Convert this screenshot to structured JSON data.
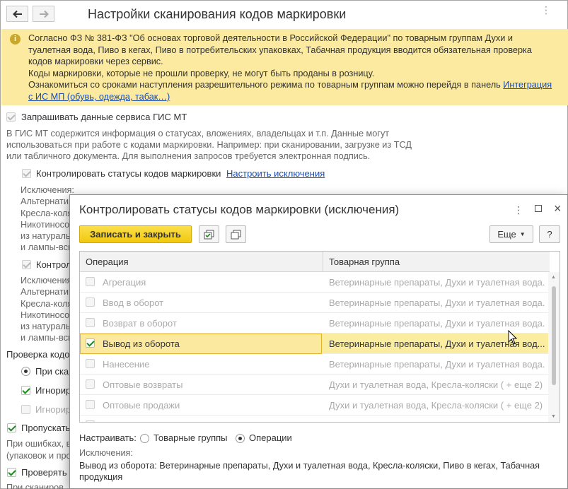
{
  "main": {
    "title": "Настройки сканирования кодов маркировки",
    "warning_lines": [
      "Согласно ФЗ № 381-ФЗ \"Об основах торговой деятельности в Российской Федерации\" по товарным группам Духи и",
      "туалетная вода, Пиво в кегах, Пиво в потребительских упаковках, Табачная продукция вводится обязательная проверка",
      "кодов маркировки через сервис.",
      "Коды маркировки, которые не прошли проверку, не могут быть проданы в розницу.",
      "Ознакомиться со сроками наступления разрешительного режима по товарным группам можно перейдя в панель "
    ],
    "warning_link_a": "Интеграция",
    "warning_link_b": "с ИС МП (обувь, одежда, табак…)",
    "gis_checkbox_label": "Запрашивать данные сервиса ГИС МТ",
    "gis_description": [
      "В ГИС МТ содержится информация о статусах, вложениях, владельцах и т.п. Данные могут",
      "использоваться при работе с кодами маркировки. Например: при сканировании, загрузке из ТСД",
      "или табличного документа. Для выполнения запросов требуется электронная подпись."
    ],
    "control_status_label": "Контролировать статусы кодов маркировки",
    "configure_exceptions_link": "Настроить исключения",
    "exceptions_block1": [
      "Исключения:",
      "Альтернатив",
      "Кресла-коляс",
      "Никотиносо",
      "из натураль",
      "и лампы-всп"
    ],
    "control_label_2": "Контрол",
    "exceptions_block2": [
      "Исключения",
      "Альтернатив",
      "Кресла-коляс",
      "Никотиносо",
      "из натураль",
      "и лампы-всп"
    ],
    "verify_codes_label": "Проверка кодо",
    "radio_scan_label": "При скан",
    "ignore_label_1": "Игнорир",
    "ignore_label_2": "Игнорир",
    "skip_label": "Пропускать",
    "skip_desc": [
      "При ошибках, в",
      "(упаковок и про"
    ],
    "check_label": "Проверять а",
    "scan_partial": "При сканиров"
  },
  "dialog": {
    "title": "Контролировать статусы кодов маркировки (исключения)",
    "save_close": "Записать и закрыть",
    "more": "Еще",
    "help": "?",
    "col_operation": "Операция",
    "col_group": "Товарная группа",
    "rows": [
      {
        "op": "Агрегация",
        "group": "Ветеринарные препараты, Духи и туалетная вода...",
        "checked": false
      },
      {
        "op": "Ввод в оборот",
        "group": "Ветеринарные препараты, Духи и туалетная вода...",
        "checked": false
      },
      {
        "op": "Возврат в оборот",
        "group": "Ветеринарные препараты, Духи и туалетная вода...",
        "checked": false
      },
      {
        "op": "Вывод из оборота",
        "group": "Ветеринарные препараты, Духи и туалетная вод...",
        "checked": true
      },
      {
        "op": "Нанесение",
        "group": "Ветеринарные препараты, Духи и туалетная вода...",
        "checked": false
      },
      {
        "op": "Оптовые возвраты",
        "group": "Духи и туалетная вода, Кресла-коляски ( + еще 2)",
        "checked": false
      },
      {
        "op": "Оптовые продажи",
        "group": "Духи и туалетная вода, Кресла-коляски ( + еще 2)",
        "checked": false
      },
      {
        "op": "П",
        "group": "Д",
        "checked": false
      }
    ],
    "configure_label": "Настраивать:",
    "radio_groups": "Товарные группы",
    "radio_operations": "Операции",
    "exceptions_title": "Исключения:",
    "exceptions_text": "Вывод из оборота: Ветеринарные препараты, Духи и туалетная вода, Кресла-коляски, Пиво в кегах, Табачная",
    "exceptions_text2": "продукция"
  },
  "colors": {
    "warning_bg": "#fbeaa0",
    "primary_button": "#f7d31f",
    "link": "#1a4db3",
    "selected_row": "#fbeda0"
  }
}
